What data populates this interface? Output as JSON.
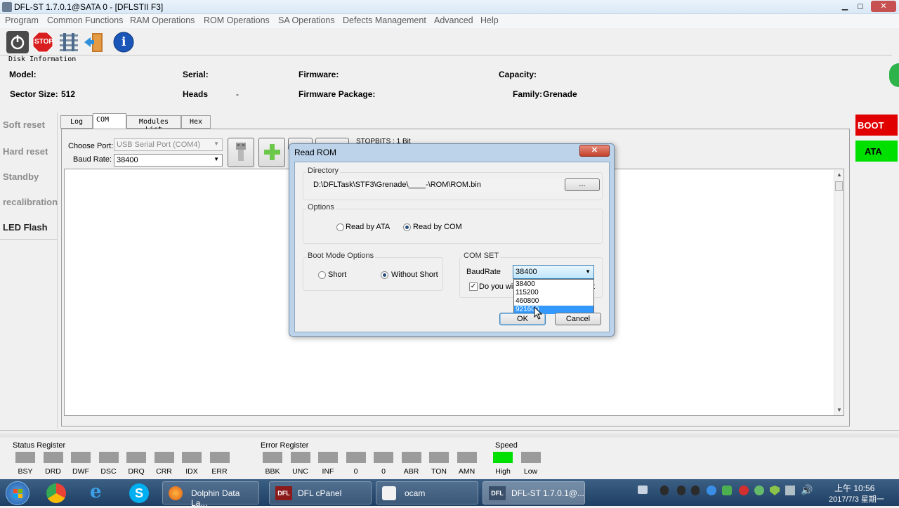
{
  "window": {
    "title": "DFL-ST 1.7.0.1@SATA 0 - [DFLSTII  F3]",
    "min": "▁",
    "max": "◻",
    "close": "✕"
  },
  "menu": [
    "Program",
    "Common Functions",
    "RAM Operations",
    "ROM Operations",
    "SA Operations",
    "Defects Management",
    "Advanced",
    "Help"
  ],
  "toolbar": {
    "stop_label": "STOP",
    "info_label": "i"
  },
  "disk_info": {
    "group_title": "Disk Information",
    "model_label": "Model:",
    "model_value": "",
    "serial_label": "Serial:",
    "serial_value": "",
    "firmware_label": "Firmware:",
    "firmware_value": "",
    "capacity_label": "Capacity:",
    "capacity_value": "",
    "sector_label": "Sector Size:",
    "sector_value": "512",
    "heads_label": "Heads",
    "heads_value": "-",
    "package_label": "Firmware Package:",
    "package_value": "",
    "family_label": "Family:",
    "family_value": "Grenade"
  },
  "left_panel": [
    "Soft reset",
    "Hard reset",
    "Standby",
    "recalibration",
    "LED Flash"
  ],
  "right_panel": {
    "boot": "BOOT",
    "ata": "ATA"
  },
  "tabs": [
    "Log",
    "COM",
    "Modules List",
    "Hex"
  ],
  "com": {
    "port_label": "Choose Port:",
    "port_value": "USB Serial Port (COM4)",
    "baud_label": "Baud Rate:",
    "baud_value": "38400",
    "stopbits": "STOPBITS : 1 Bit"
  },
  "dialog": {
    "title": "Read ROM",
    "close": "✕",
    "directory_title": "Directory",
    "directory_value": "D:\\DFLTask\\STF3\\Grenade\\____-\\ROM\\ROM.bin",
    "browse_label": "...",
    "options_title": "Options",
    "read_ata": "Read by ATA",
    "read_com": "Read by COM",
    "boot_title": "Boot Mode Options",
    "short": "Short",
    "without_short": "Without Short",
    "comset_title": "COM SET",
    "baudrate_label": "BaudRate",
    "baudrate_value": "38400",
    "baud_options": [
      "38400",
      "115200",
      "460800",
      "921600"
    ],
    "checkbox_text": "Do you wis",
    "checkbox_tail": "t",
    "ok": "OK",
    "cancel": "Cancel"
  },
  "status": {
    "status_title": "Status Register",
    "status_leds": [
      "BSY",
      "DRD",
      "DWF",
      "DSC",
      "DRQ",
      "CRR",
      "IDX",
      "ERR"
    ],
    "error_title": "Error Register",
    "error_leds": [
      "BBK",
      "UNC",
      "INF",
      "0",
      "0",
      "ABR",
      "TON",
      "AMN"
    ],
    "speed_title": "Speed",
    "speed_leds": [
      "High",
      "Low"
    ]
  },
  "taskbar": {
    "tasks": [
      "Dolphin Data La...",
      "DFL cPanel",
      "ocam",
      "DFL-ST 1.7.0.1@..."
    ],
    "time": "上午 10:56",
    "date": "2017/7/3 星期一"
  },
  "colors": {
    "boot": "#e10000",
    "ata": "#00e000",
    "speed_high": "#00e000",
    "selection": "#3399ff"
  }
}
